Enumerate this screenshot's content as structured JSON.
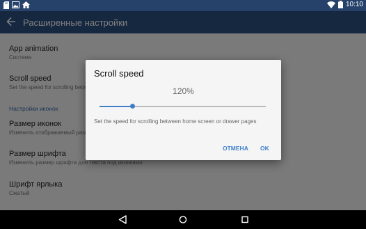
{
  "status_bar": {
    "time": "10:10",
    "icons": [
      "sd-card-icon",
      "image-icon",
      "home-icon",
      "wifi-icon",
      "battery-icon"
    ]
  },
  "app_bar": {
    "title": "Расширенные настройки"
  },
  "preferences": [
    {
      "title": "App animation",
      "summary": "Система"
    },
    {
      "title": "Scroll speed",
      "summary": "Set the speed for scrolling between home screen or drawer pages"
    },
    {
      "title": "Размер иконок",
      "summary": "Изменить отображаемый размер иконок"
    },
    {
      "title": "Размер шрифта",
      "summary": "Изменить размер шрифта для текста под иконками"
    },
    {
      "title": "Шрифт ярлыка",
      "summary": "Сжатый"
    }
  ],
  "section_header": "Настройки иконок",
  "dialog": {
    "title": "Scroll speed",
    "value": "120%",
    "slider_fraction": 0.2,
    "description": "Set the speed for scrolling between home screen or drawer pages",
    "cancel": "ОТМЕНА",
    "ok": "OK"
  },
  "colors": {
    "app_bar": "#2d4f80",
    "status_bar": "#26426a",
    "accent": "#3f7fc9"
  },
  "nav_bar": {
    "icons": [
      "back-icon",
      "home-icon",
      "recents-icon"
    ]
  }
}
